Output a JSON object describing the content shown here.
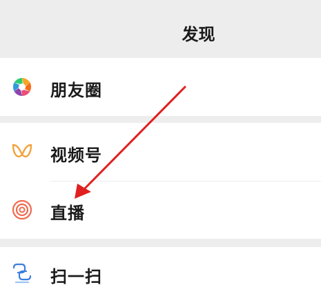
{
  "header": {
    "title": "发现"
  },
  "items": [
    {
      "label": "朋友圈",
      "icon": "moments-icon"
    },
    {
      "label": "视频号",
      "icon": "channels-icon"
    },
    {
      "label": "直播",
      "icon": "live-icon"
    },
    {
      "label": "扫一扫",
      "icon": "scan-icon"
    }
  ],
  "colors": {
    "background": "#ededed",
    "row_background": "#ffffff",
    "arrow": "#e02020",
    "channels_icon": "#f2a23a",
    "live_icon": "#ef6a50",
    "scan_icon": "#3e7de0"
  }
}
